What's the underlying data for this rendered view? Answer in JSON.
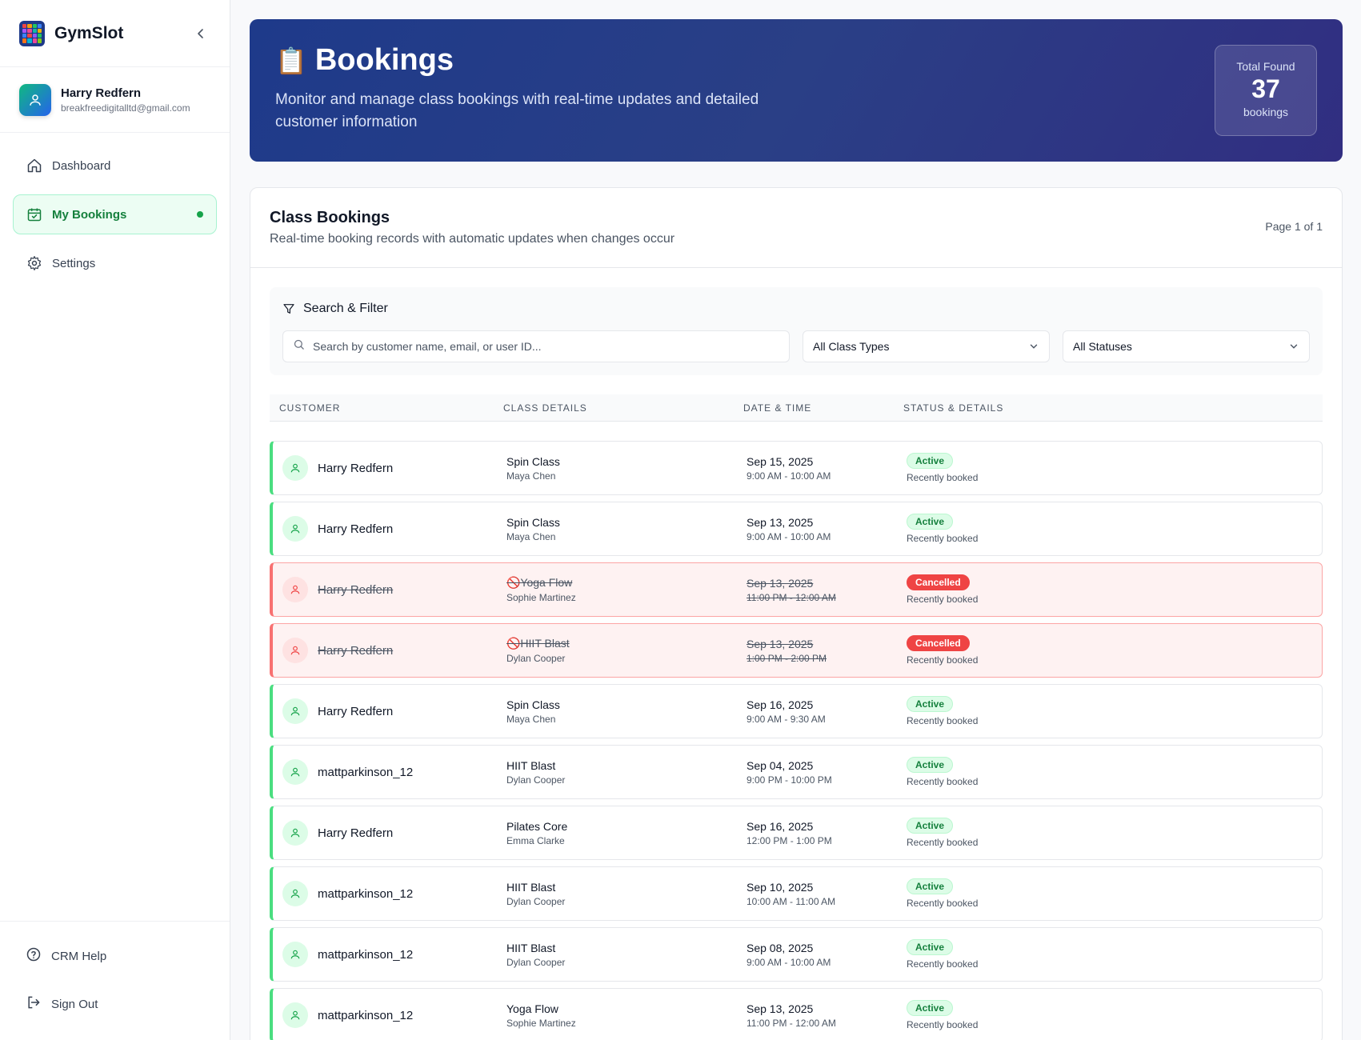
{
  "app": {
    "name": "GymSlot"
  },
  "user": {
    "name": "Harry Redfern",
    "email": "breakfreedigitalltd@gmail.com"
  },
  "nav": {
    "dashboard": "Dashboard",
    "bookings": "My Bookings",
    "settings": "Settings",
    "help": "CRM Help",
    "signout": "Sign Out"
  },
  "hero": {
    "icon": "📋",
    "title": "Bookings",
    "subtitle": "Monitor and manage class bookings with real-time updates and detailed customer information",
    "total_label": "Total Found",
    "total_value": "37",
    "total_unit": "bookings"
  },
  "card": {
    "title": "Class Bookings",
    "subtitle": "Real-time booking records with automatic updates when changes occur",
    "page": "Page 1 of 1"
  },
  "filter": {
    "title": "Search & Filter",
    "search_placeholder": "Search by customer name, email, or user ID...",
    "class_type": "All Class Types",
    "status": "All Statuses"
  },
  "table": {
    "headers": [
      "CUSTOMER",
      "CLASS DETAILS",
      "DATE & TIME",
      "STATUS & DETAILS"
    ],
    "rows": [
      {
        "customer": "Harry Redfern",
        "class": "Spin Class",
        "instructor": "Maya Chen",
        "date": "Sep 15, 2025",
        "time": "9:00 AM - 10:00 AM",
        "status": "Active",
        "note": "Recently booked",
        "cancelled": false
      },
      {
        "customer": "Harry Redfern",
        "class": "Spin Class",
        "instructor": "Maya Chen",
        "date": "Sep 13, 2025",
        "time": "9:00 AM - 10:00 AM",
        "status": "Active",
        "note": "Recently booked",
        "cancelled": false
      },
      {
        "customer": "Harry Redfern",
        "class": "🚫Yoga Flow",
        "instructor": "Sophie Martinez",
        "date": "Sep 13, 2025",
        "time": "11:00 PM - 12:00 AM",
        "status": "Cancelled",
        "note": "Recently booked",
        "cancelled": true
      },
      {
        "customer": "Harry Redfern",
        "class": "🚫HIIT Blast",
        "instructor": "Dylan Cooper",
        "date": "Sep 13, 2025",
        "time": "1:00 PM - 2:00 PM",
        "status": "Cancelled",
        "note": "Recently booked",
        "cancelled": true
      },
      {
        "customer": "Harry Redfern",
        "class": "Spin Class",
        "instructor": "Maya Chen",
        "date": "Sep 16, 2025",
        "time": "9:00 AM - 9:30 AM",
        "status": "Active",
        "note": "Recently booked",
        "cancelled": false
      },
      {
        "customer": "mattparkinson_12",
        "class": "HIIT Blast",
        "instructor": "Dylan Cooper",
        "date": "Sep 04, 2025",
        "time": "9:00 PM - 10:00 PM",
        "status": "Active",
        "note": "Recently booked",
        "cancelled": false
      },
      {
        "customer": "Harry Redfern",
        "class": "Pilates Core",
        "instructor": "Emma Clarke",
        "date": "Sep 16, 2025",
        "time": "12:00 PM - 1:00 PM",
        "status": "Active",
        "note": "Recently booked",
        "cancelled": false
      },
      {
        "customer": "mattparkinson_12",
        "class": "HIIT Blast",
        "instructor": "Dylan Cooper",
        "date": "Sep 10, 2025",
        "time": "10:00 AM - 11:00 AM",
        "status": "Active",
        "note": "Recently booked",
        "cancelled": false
      },
      {
        "customer": "mattparkinson_12",
        "class": "HIIT Blast",
        "instructor": "Dylan Cooper",
        "date": "Sep 08, 2025",
        "time": "9:00 AM - 10:00 AM",
        "status": "Active",
        "note": "Recently booked",
        "cancelled": false
      },
      {
        "customer": "mattparkinson_12",
        "class": "Yoga Flow",
        "instructor": "Sophie Martinez",
        "date": "Sep 13, 2025",
        "time": "11:00 PM - 12:00 AM",
        "status": "Active",
        "note": "Recently booked",
        "cancelled": false
      }
    ]
  },
  "colors": {
    "accent_green": "#16a34a",
    "cancel_red": "#ef4444",
    "hero_navy": "#1e3a8a"
  }
}
